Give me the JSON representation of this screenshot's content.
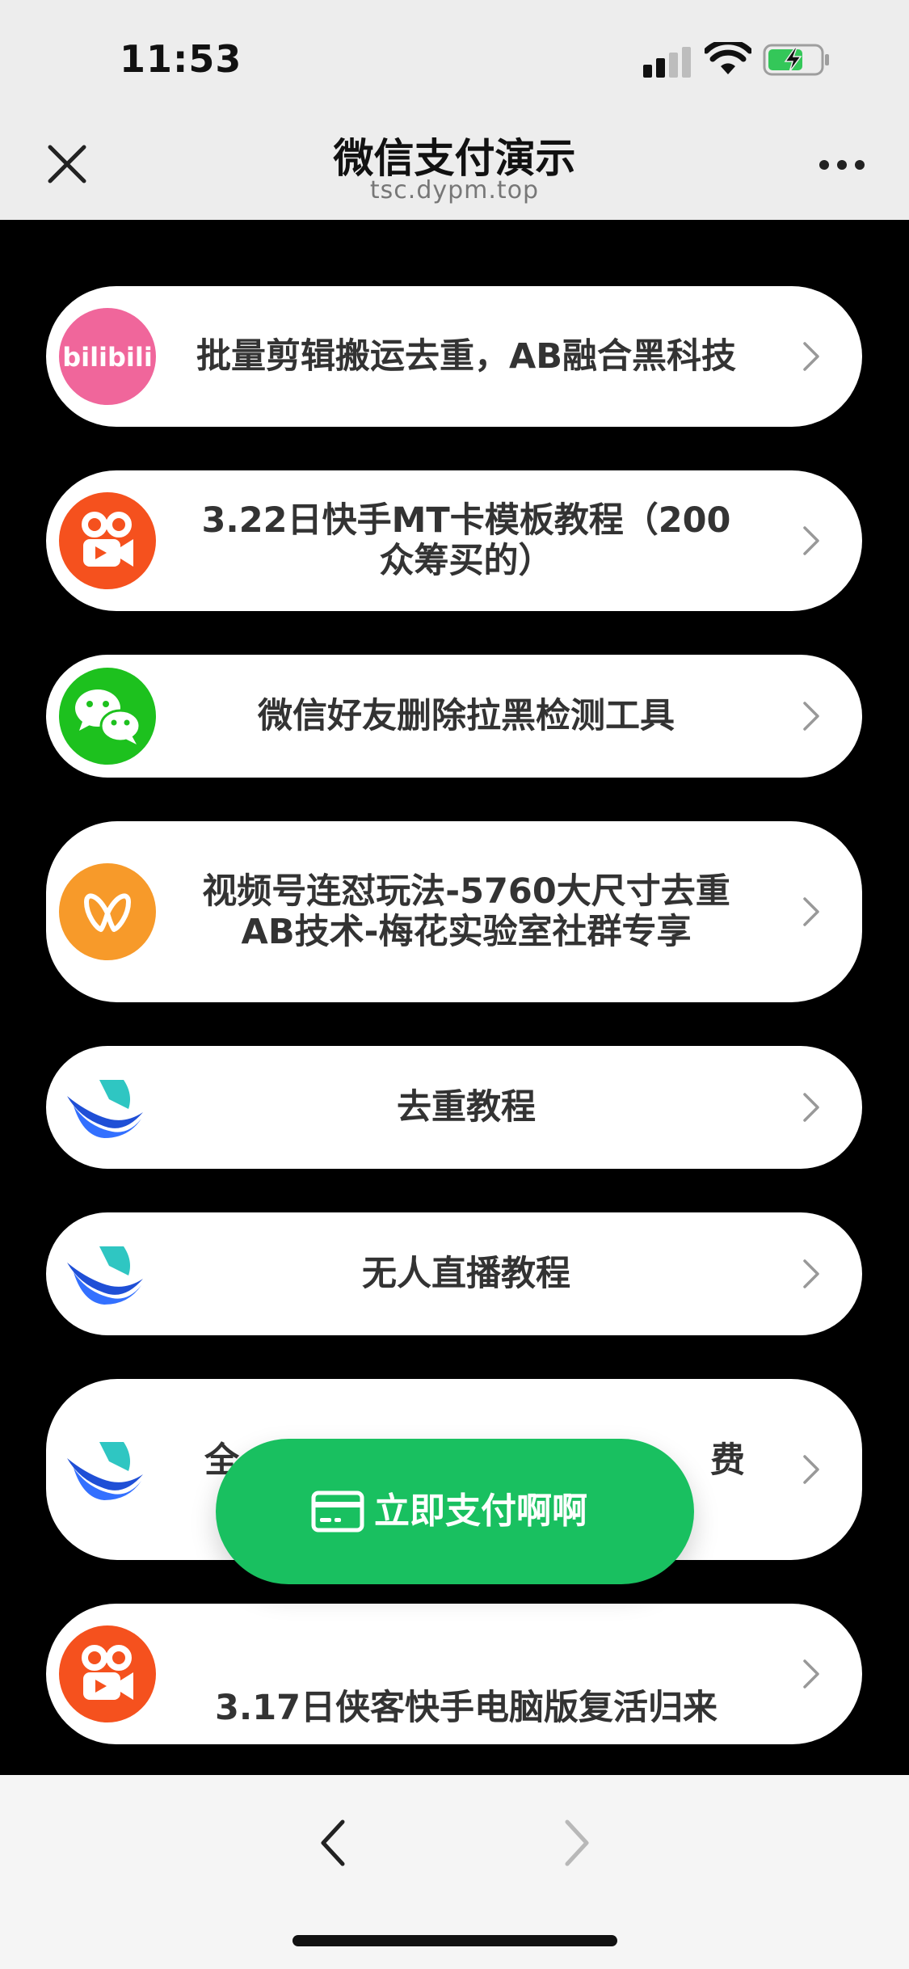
{
  "status_bar": {
    "time": "11:53",
    "icons": [
      "signal-icon",
      "wifi-icon",
      "battery-charging-icon"
    ]
  },
  "header": {
    "title": "微信支付演示",
    "url": "tsc.dypm.top",
    "icons": [
      "close-icon",
      "more-icon"
    ]
  },
  "items": [
    {
      "label": "批量剪辑搬运去重，AB融合黑科技",
      "icon": "bilibili-icon",
      "icon_text": "bilibili"
    },
    {
      "label": "3.22日快手MT卡模板教程（200众筹买的）",
      "icon": "kuaishou-icon"
    },
    {
      "label": "微信好友删除拉黑检测工具",
      "icon": "wechat-icon"
    },
    {
      "label": "视频号连怼玩法-5760大尺寸去重AB技术-梅花实验室社群专享",
      "icon": "channels-icon"
    },
    {
      "label": "去重教程",
      "icon": "feishu-icon"
    },
    {
      "label": "无人直播教程",
      "icon": "feishu-icon"
    },
    {
      "label": "全",
      "label_right": "费",
      "icon": "feishu-icon"
    },
    {
      "label": "3.17日侠客快手电脑版复活归来",
      "icon": "kuaishou-icon"
    }
  ],
  "pay_button": {
    "label": "立即支付啊啊",
    "icon": "card-icon"
  },
  "toolbar": {
    "icons": [
      "back-icon",
      "forward-icon"
    ]
  },
  "colors": {
    "header_bg": "#ededed",
    "content_bg": "#000000",
    "pay_green": "#19c060",
    "bilibili_pink": "#f0669b",
    "kuaishou_orange": "#f5511e",
    "wechat_green": "#1dc11e",
    "channels_orange": "#f79a2a",
    "feishu_blue": "#3370ff"
  }
}
